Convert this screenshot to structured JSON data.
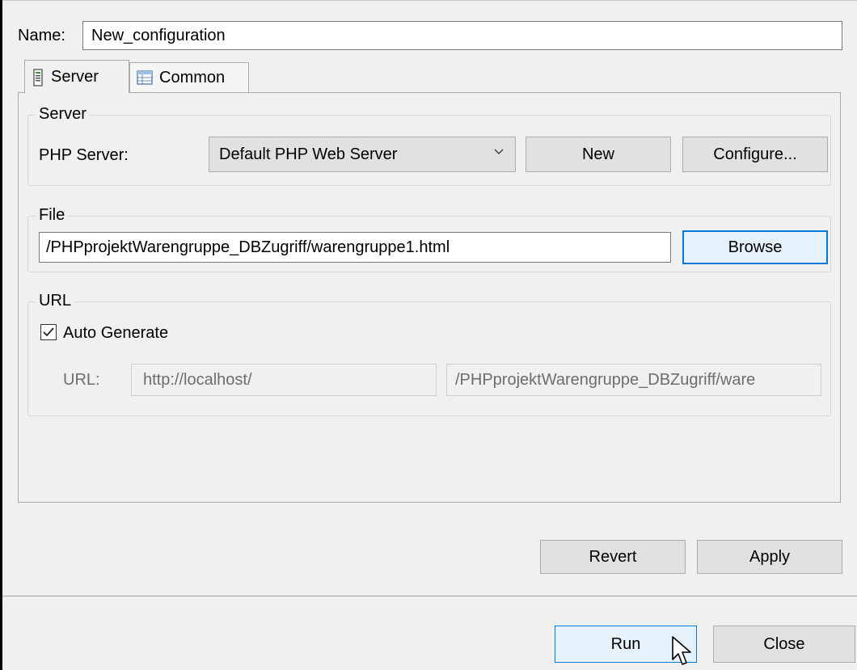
{
  "name": {
    "label": "Name:",
    "value": "New_configuration"
  },
  "tabs": [
    {
      "label": "Server",
      "icon": "server-icon",
      "active": true
    },
    {
      "label": "Common",
      "icon": "table-icon",
      "active": false
    }
  ],
  "server_group": {
    "title": "Server",
    "php_server_label": "PHP Server:",
    "php_server_value": "Default PHP Web Server",
    "new_button": "New",
    "configure_button": "Configure..."
  },
  "file_group": {
    "title": "File",
    "path": "/PHPprojektWarengruppe_DBZugriff/warengruppe1.html",
    "browse_button": "Browse"
  },
  "url_group": {
    "title": "URL",
    "auto_generate_label": "Auto Generate",
    "auto_generate_checked": true,
    "url_label": "URL:",
    "url_host": "http://localhost/",
    "url_path": "/PHPprojektWarengruppe_DBZugriff/ware"
  },
  "buttons": {
    "revert": "Revert",
    "apply": "Apply",
    "run": "Run",
    "close": "Close"
  },
  "colors": {
    "focus": "#0078d7",
    "button_bg": "#e1e1e1",
    "window_bg": "#f0f0f0"
  }
}
